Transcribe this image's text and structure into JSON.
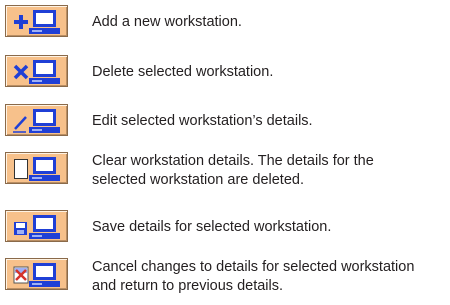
{
  "accent": {
    "button_bg": "#f7c18b",
    "monitor_blue": "#1f3fd6",
    "action_red": "#d4332b"
  },
  "items": [
    {
      "icon": "add-workstation-icon",
      "lines": [
        "Add a new workstation."
      ]
    },
    {
      "icon": "delete-workstation-icon",
      "lines": [
        "Delete selected workstation."
      ]
    },
    {
      "icon": "edit-workstation-icon",
      "lines": [
        "Edit selected workstation’s details."
      ]
    },
    {
      "icon": "clear-workstation-icon",
      "lines": [
        "Clear workstation details. The details for the",
        "selected workstation are deleted."
      ]
    },
    {
      "icon": "save-workstation-icon",
      "lines": [
        "Save details for selected workstation."
      ]
    },
    {
      "icon": "cancel-workstation-icon",
      "lines": [
        "Cancel changes to details for selected workstation",
        "and return to previous details."
      ]
    }
  ]
}
